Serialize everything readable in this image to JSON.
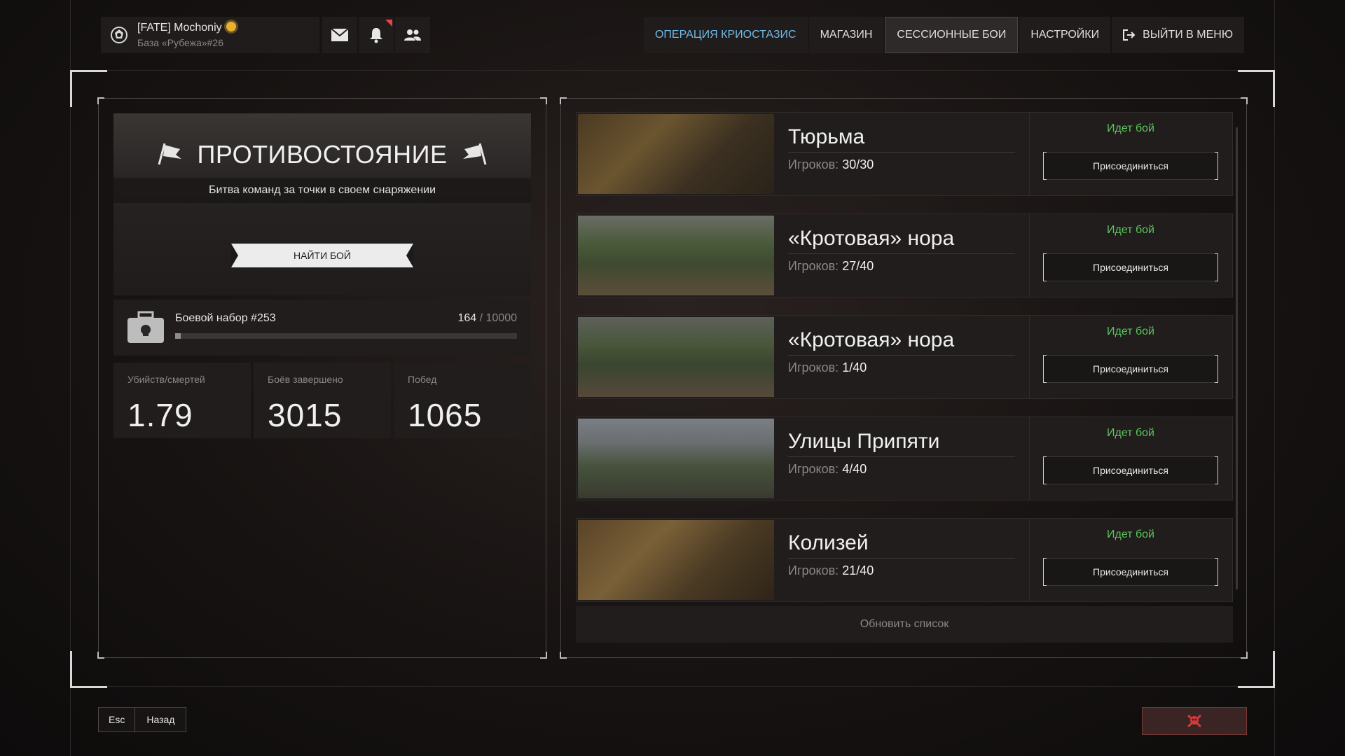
{
  "profile": {
    "name": "[FATE] Mochoniy",
    "base": "База «Рубежа»#26"
  },
  "topnav": {
    "items": [
      {
        "label": "ОПЕРАЦИЯ КРИОСТАЗИС"
      },
      {
        "label": "МАГАЗИН"
      },
      {
        "label": "СЕССИОННЫЕ БОИ"
      },
      {
        "label": "НАСТРОЙКИ"
      },
      {
        "label": "ВЫЙТИ В МЕНЮ"
      }
    ]
  },
  "mode": {
    "title": "ПРОТИВОСТОЯНИЕ",
    "subtitle": "Битва команд за точки в своем снаряжении",
    "find_button": "НАЙТИ БОЙ"
  },
  "kit": {
    "name": "Боевой набор #253",
    "current": "164",
    "separator": "/",
    "max": "10000",
    "progress": 0.0164
  },
  "stats": [
    {
      "label": "Убийств/смертей",
      "value": "1.79"
    },
    {
      "label": "Боёв завершено",
      "value": "3015"
    },
    {
      "label": "Побед",
      "value": "1065"
    }
  ],
  "servers": [
    {
      "map": "Тюрьма",
      "players_label": "Игроков:",
      "players": "30/30",
      "status": "Идет бой",
      "join": "Присоединиться"
    },
    {
      "map": "«Кротовая» нора",
      "players_label": "Игроков:",
      "players": "27/40",
      "status": "Идет бой",
      "join": "Присоединиться"
    },
    {
      "map": "«Кротовая» нора",
      "players_label": "Игроков:",
      "players": "1/40",
      "status": "Идет бой",
      "join": "Присоединиться"
    },
    {
      "map": "Улицы Припяти",
      "players_label": "Игроков:",
      "players": "4/40",
      "status": "Идет бой",
      "join": "Присоединиться"
    },
    {
      "map": "Колизей",
      "players_label": "Игроков:",
      "players": "21/40",
      "status": "Идет бой",
      "join": "Присоединиться"
    }
  ],
  "refresh_label": "Обновить список",
  "footer": {
    "esc_key": "Esc",
    "back_label": "Назад"
  },
  "colors": {
    "accent_blue": "#6fb9e6",
    "status_green": "#5cc45c",
    "danger_red": "#d23a3a"
  }
}
